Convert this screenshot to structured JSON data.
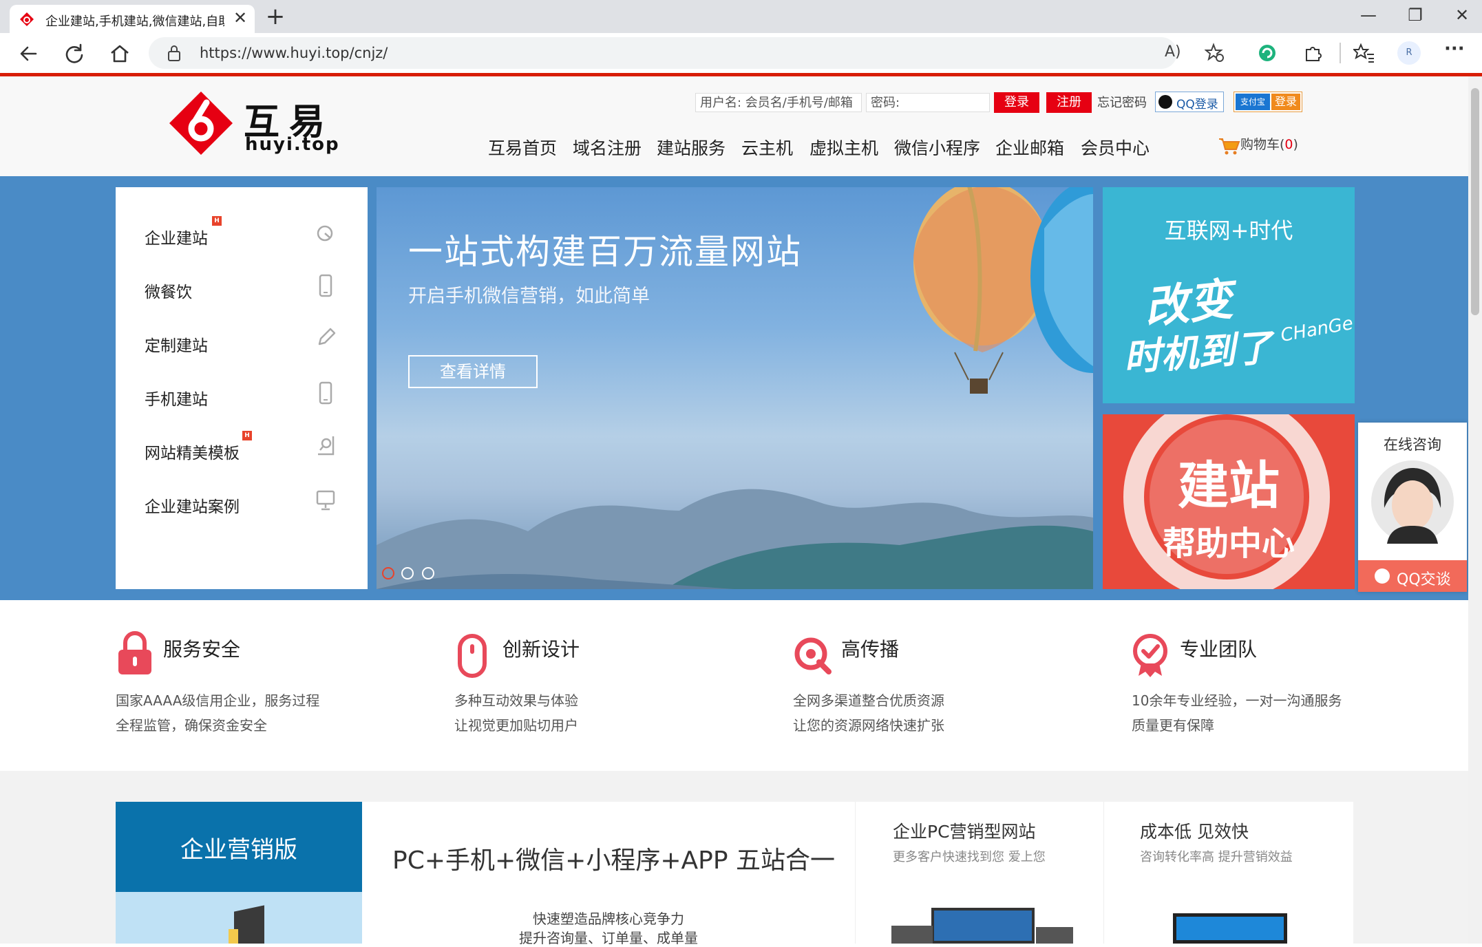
{
  "browser": {
    "tab_title": "企业建站,手机建站,微信建站,自助",
    "url": "https://www.huyi.top/cnjz/",
    "avatar_letter": "R"
  },
  "header": {
    "logo_cn": "互易",
    "logo_en": "huyi.top",
    "username_placeholder": "用户名: 会员名/手机号/邮箱",
    "password_placeholder": "密码:",
    "login_label": "登录",
    "register_label": "注册",
    "forgot_label": "忘记密码",
    "qq_login_label": "QQ登录",
    "alipay_label": "支付宝",
    "alipay_login_label": "登录",
    "cart_label": "购物车(",
    "cart_count": "0",
    "cart_close": ")",
    "nav": [
      "互易首页",
      "域名注册",
      "建站服务",
      "云主机",
      "虚拟主机",
      "微信小程序",
      "企业邮箱",
      "会员中心"
    ]
  },
  "sidemenu": [
    {
      "label": "企业建站",
      "hot": "H"
    },
    {
      "label": "微餐饮"
    },
    {
      "label": "定制建站"
    },
    {
      "label": "手机建站"
    },
    {
      "label": "网站精美模板",
      "hot": "H"
    },
    {
      "label": "企业建站案例"
    }
  ],
  "banner": {
    "headline": "一站式构建百万流量网站",
    "subline": "开启手机微信营销，如此简单",
    "button": "查看详情"
  },
  "promo1": {
    "title": "互联网+时代",
    "line1": "改变",
    "line2": "时机到了",
    "en": "CHanGe"
  },
  "promo2": {
    "line1": "建站",
    "line2": "帮助中心"
  },
  "consult": {
    "title": "在线咨询",
    "qq_label": "QQ交谈"
  },
  "features": [
    {
      "title": "服务安全",
      "desc1": "国家AAAA级信用企业，服务过程",
      "desc2": "全程监管，确保资金安全"
    },
    {
      "title": "创新设计",
      "desc1": "多种互动效果与体验",
      "desc2": "让视觉更加贴切用户"
    },
    {
      "title": "高传播",
      "desc1": "全网多渠道整合优质资源",
      "desc2": "让您的资源网络快速扩张"
    },
    {
      "title": "专业团队",
      "desc1": "10余年专业经验，一对一沟通服务",
      "desc2": "质量更有保障"
    }
  ],
  "products": {
    "edition": "企业营销版",
    "headline": "PC+手机+微信+小程序+APP 五站合一",
    "sub1": "快速塑造品牌核心竞争力",
    "sub2": "提升咨询量、订单量、成单量",
    "card1_title": "企业PC营销型网站",
    "card1_sub": "更多客户快速找到您 爱上您",
    "card2_title": "成本低 见效快",
    "card2_sub": "咨询转化率高 提升营销效益"
  },
  "colors": {
    "brand_red": "#e60012",
    "banner_blue": "#4a8bc6",
    "edition_blue": "#0a72ab"
  }
}
